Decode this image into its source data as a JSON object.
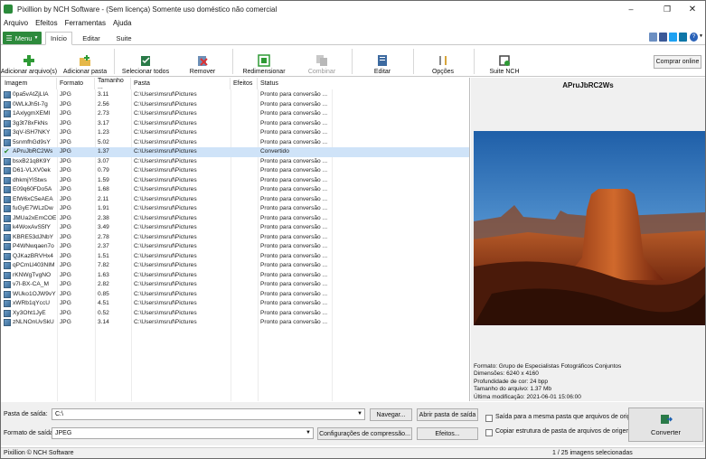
{
  "window": {
    "title": "Pixillion by NCH Software - (Sem licença) Somente uso doméstico não comercial"
  },
  "menubar": [
    "Arquivo",
    "Efeitos",
    "Ferramentas",
    "Ajuda"
  ],
  "tabs": {
    "menu": "Menu",
    "items": [
      "Início",
      "Editar",
      "Suite"
    ]
  },
  "toolbar": {
    "add_file": "Adicionar arquivo(s)",
    "add_folder": "Adicionar pasta",
    "select_all": "Selecionar todos",
    "remove": "Remover",
    "resize": "Redimensionar",
    "combine": "Combinar",
    "edit": "Editar",
    "options": "Opções",
    "suite": "Suite NCH",
    "buy": "Comprar online"
  },
  "table": {
    "headers": [
      "Imagem",
      "Formato",
      "Tamanho ...",
      "Pasta",
      "Efeitos",
      "Status"
    ],
    "rows": [
      {
        "name": "0pa5vAtZjLIA",
        "format": "JPG",
        "size": "3.11",
        "folder": "C:\\Users\\msruf\\Pictures",
        "status": "Pronto para conversão ..."
      },
      {
        "name": "0WLkJh5t-7g",
        "format": "JPG",
        "size": "2.56",
        "folder": "C:\\Users\\msruf\\Pictures",
        "status": "Pronto para conversão ..."
      },
      {
        "name": "1AxlygmXEMI",
        "format": "JPG",
        "size": "2.73",
        "folder": "C:\\Users\\msruf\\Pictures",
        "status": "Pronto para conversão ..."
      },
      {
        "name": "3g3t78xFkNs",
        "format": "JPG",
        "size": "3.17",
        "folder": "C:\\Users\\msruf\\Pictures",
        "status": "Pronto para conversão ..."
      },
      {
        "name": "3qV-iSH7NKY",
        "format": "JPG",
        "size": "1.23",
        "folder": "C:\\Users\\msruf\\Pictures",
        "status": "Pronto para conversão ..."
      },
      {
        "name": "5snmfhGd9sY",
        "format": "JPG",
        "size": "5.02",
        "folder": "C:\\Users\\msruf\\Pictures",
        "status": "Pronto para conversão ..."
      },
      {
        "name": "APruJbRC2Ws",
        "format": "JPG",
        "size": "1.37",
        "folder": "C:\\Users\\msruf\\Pictures",
        "status": "Convertido",
        "selected": true
      },
      {
        "name": "bsxB21q8K9Y",
        "format": "JPG",
        "size": "3.07",
        "folder": "C:\\Users\\msruf\\Pictures",
        "status": "Pronto para conversão ..."
      },
      {
        "name": "D61-VLXV0ek",
        "format": "JPG",
        "size": "0.79",
        "folder": "C:\\Users\\msruf\\Pictures",
        "status": "Pronto para conversão ..."
      },
      {
        "name": "dhkmjYlStws",
        "format": "JPG",
        "size": "1.59",
        "folder": "C:\\Users\\msruf\\Pictures",
        "status": "Pronto para conversão ..."
      },
      {
        "name": "E09q60FDo5A",
        "format": "JPG",
        "size": "1.68",
        "folder": "C:\\Users\\msruf\\Pictures",
        "status": "Pronto para conversão ..."
      },
      {
        "name": "EfW6xC5eAEA",
        "format": "JPG",
        "size": "2.11",
        "folder": "C:\\Users\\msruf\\Pictures",
        "status": "Pronto para conversão ..."
      },
      {
        "name": "fuGyE7WLzDw",
        "format": "JPG",
        "size": "1.91",
        "folder": "C:\\Users\\msruf\\Pictures",
        "status": "Pronto para conversão ..."
      },
      {
        "name": "JMUa2xEmCOE",
        "format": "JPG",
        "size": "2.38",
        "folder": "C:\\Users\\msruf\\Pictures",
        "status": "Pronto para conversão ..."
      },
      {
        "name": "k4WoxAvS5fY",
        "format": "JPG",
        "size": "3.49",
        "folder": "C:\\Users\\msruf\\Pictures",
        "status": "Pronto para conversão ..."
      },
      {
        "name": "KBRE53dJNbY",
        "format": "JPG",
        "size": "2.78",
        "folder": "C:\\Users\\msruf\\Pictures",
        "status": "Pronto para conversão ..."
      },
      {
        "name": "P4WNwqaen7o",
        "format": "JPG",
        "size": "2.37",
        "folder": "C:\\Users\\msruf\\Pictures",
        "status": "Pronto para conversão ..."
      },
      {
        "name": "QJKazBRVHx4",
        "format": "JPG",
        "size": "1.51",
        "folder": "C:\\Users\\msruf\\Pictures",
        "status": "Pronto para conversão ..."
      },
      {
        "name": "qPCmLl403NIM",
        "format": "JPG",
        "size": "7.82",
        "folder": "C:\\Users\\msruf\\Pictures",
        "status": "Pronto para conversão ..."
      },
      {
        "name": "rKNWgTvgNO",
        "format": "JPG",
        "size": "1.63",
        "folder": "C:\\Users\\msruf\\Pictures",
        "status": "Pronto para conversão ..."
      },
      {
        "name": "v7l-BX-CA_M",
        "format": "JPG",
        "size": "2.82",
        "folder": "C:\\Users\\msruf\\Pictures",
        "status": "Pronto para conversão ..."
      },
      {
        "name": "WUko1OJW9vY",
        "format": "JPG",
        "size": "0.85",
        "folder": "C:\\Users\\msruf\\Pictures",
        "status": "Pronto para conversão ..."
      },
      {
        "name": "xWRb1qYccU",
        "format": "JPG",
        "size": "4.51",
        "folder": "C:\\Users\\msruf\\Pictures",
        "status": "Pronto para conversão ..."
      },
      {
        "name": "Xy3Oht1JyE",
        "format": "JPG",
        "size": "0.52",
        "folder": "C:\\Users\\msruf\\Pictures",
        "status": "Pronto para conversão ..."
      },
      {
        "name": "zNLNOnUvSkU",
        "format": "JPG",
        "size": "3.14",
        "folder": "C:\\Users\\msruf\\Pictures",
        "status": "Pronto para conversão ..."
      }
    ]
  },
  "preview": {
    "title": "APruJbRC2Ws",
    "info": [
      "Formato: Grupo de Especialistas Fotográficos Conjuntos",
      "Dimensões: 6240 x 4160",
      "Profundidade de cor: 24 bpp",
      "Tamanho do arquivo: 1.37 Mb",
      "Última modificação: 2021-06-01 15:06:00"
    ]
  },
  "output": {
    "folder_label": "Pasta de saída:",
    "folder_value": "C:\\",
    "browse": "Navegar...",
    "open_folder": "Abrir pasta de saída",
    "format_label": "Formato de saída:",
    "format_value": "JPEG",
    "compression": "Configurações de compressão...",
    "effects": "Efeitos...",
    "same_folder": "Saída para a mesma pasta que arquivos de origem",
    "copy_structure": "Copiar estrutura de pasta de arquivos de origem",
    "convert": "Converter"
  },
  "status": {
    "left": "Pixillion © NCH Software",
    "right": "1 / 25 imagens selecionadas"
  }
}
